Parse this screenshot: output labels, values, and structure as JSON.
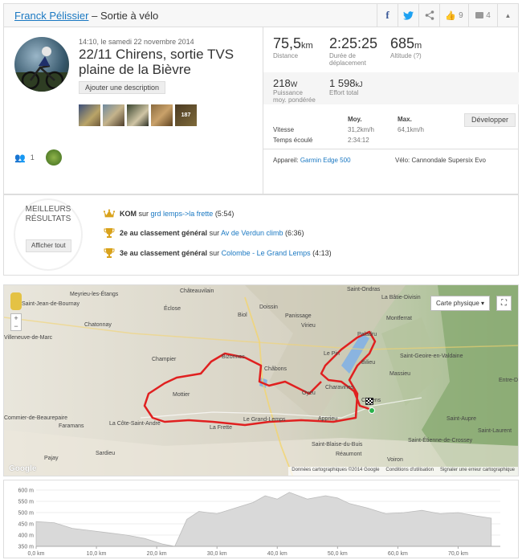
{
  "header": {
    "athlete": "Franck Pélissier",
    "separator": " – ",
    "activity_type": "Sortie à vélo",
    "kudos_count": "9",
    "comments_count": "4"
  },
  "activity": {
    "meta": "14:10, le samedi 22 novembre 2014",
    "title": "22/11 Chirens, sortie TVS plaine de la Bièvre",
    "add_description": "Ajouter une description",
    "photo_count": "187",
    "athletes_count": "1"
  },
  "stats": {
    "distance": {
      "value": "75,5",
      "unit": "km",
      "label": "Distance"
    },
    "moving_time": {
      "value": "2:25:25",
      "label1": "Durée de",
      "label2": "déplacement"
    },
    "elevation": {
      "value": "685",
      "unit": "m",
      "label": "Altitude (?)"
    },
    "power": {
      "value": "218",
      "unit": "W",
      "label1": "Puissance",
      "label2": "moy. pondérée"
    },
    "energy": {
      "value": "1 598",
      "unit": "kJ",
      "label": "Effort total"
    }
  },
  "details": {
    "col_avg": "Moy.",
    "col_max": "Max.",
    "speed_label": "Vitesse",
    "speed_avg": "31,2km/h",
    "speed_max": "64,1km/h",
    "elapsed_label": "Temps écoulé",
    "elapsed_value": "2:34:12",
    "expand_button": "Développer",
    "device_label": "Appareil:",
    "device_value": "Garmin Edge 500",
    "bike_label": "Vélo:",
    "bike_value": "Cannondale Supersix Evo"
  },
  "best": {
    "heading1": "MEILLEURS",
    "heading2": "RÉSULTATS",
    "show_all": "Afficher tout",
    "results": [
      {
        "rank": "KOM",
        "mid": " sur ",
        "segment": "grd lemps->la frette",
        "time": " (5:54)"
      },
      {
        "rank": "2e au classement général",
        "mid": " sur ",
        "segment": "Av de Verdun climb",
        "time": " (6:36)"
      },
      {
        "rank": "3e au classement général",
        "mid": " sur ",
        "segment": "Colombe - Le Grand Lemps",
        "time": " (4:13)"
      }
    ]
  },
  "map": {
    "map_type": "Carte physique",
    "google": "Google",
    "data_credit": "Données cartographiques ©2014 Google",
    "terms": "Conditions d'utilisation",
    "report": "Signaler une erreur cartographique",
    "places": [
      "Saint-Ondras",
      "Meyrieu-les-Étangs",
      "Châteauvilain",
      "La Bâtie-Divisin",
      "Saint-Jean-de-Bournay",
      "Doissin",
      "Chatonnay",
      "Éclose",
      "Biol",
      "Panissage",
      "Virieu",
      "Montferrat",
      "Villeneuve-de-Marc",
      "Paladru",
      "Le Pin",
      "Saint-Geoire-en-Valdaine",
      "Champier",
      "Bizonnes",
      "Bilieu",
      "Châbons",
      "Massieu",
      "Mottier",
      "Charavines",
      "Oyeu",
      "Chirens",
      "Entre-D",
      "Saint-Aupre",
      "Saint-Laurent",
      "Commier-de-Beaurepaire",
      "La Côte-Saint-André",
      "Le Grand-Lemps",
      "Apprieu",
      "Faramans",
      "La Frette",
      "Saint-Étienne-de-Crossey",
      "Saint-Blaise-du-Buis",
      "Sardieu",
      "Réaumont",
      "Voiron",
      "Pajay"
    ]
  },
  "elevation_chart": {
    "type": "area",
    "y_ticks": [
      "600 m",
      "550 m",
      "500 m",
      "450 m",
      "400 m",
      "350 m"
    ],
    "x_ticks": [
      "0,0 km",
      "10,0 km",
      "20,0 km",
      "30,0 km",
      "40,0 km",
      "50,0 km",
      "60,0 km",
      "70,0 km"
    ]
  },
  "chart_data": {
    "type": "area",
    "x": [
      0,
      3,
      6,
      9,
      12,
      15,
      18,
      21,
      23,
      25,
      27,
      30,
      33,
      36,
      38,
      40,
      42,
      45,
      48,
      50,
      52,
      55,
      58,
      61,
      64,
      67,
      70,
      73,
      75.5
    ],
    "y": [
      460,
      455,
      430,
      420,
      410,
      400,
      385,
      360,
      350,
      470,
      505,
      495,
      520,
      545,
      575,
      560,
      590,
      560,
      575,
      565,
      540,
      520,
      495,
      500,
      510,
      495,
      500,
      485,
      475
    ],
    "ylim": [
      350,
      600
    ],
    "xlim": [
      0,
      77
    ]
  },
  "colors": {
    "link": "#1a78c2",
    "route": "#e02020",
    "facebook": "#3b5998",
    "twitter": "#1da1f2",
    "trophy": "#d9a21b",
    "elevation_fill": "#d9d9d9"
  }
}
